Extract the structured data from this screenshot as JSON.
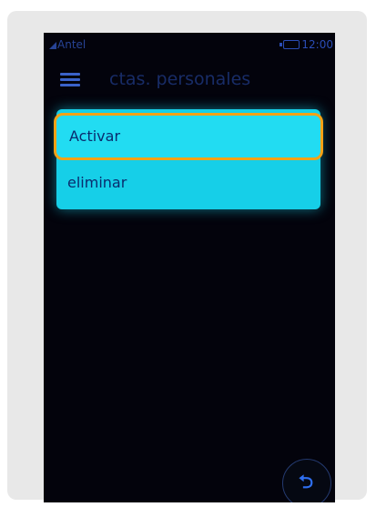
{
  "status_bar": {
    "carrier": "Antel",
    "time": "12:00",
    "signal_icon": "signal-icon",
    "battery_icon": "battery-icon"
  },
  "header": {
    "menu_icon": "menu-icon",
    "title": "ctas. personales"
  },
  "popup_menu": {
    "items": [
      {
        "label": "Activar",
        "highlighted": true
      },
      {
        "label": "eliminar",
        "highlighted": false
      }
    ],
    "background_color": "#16cfe8",
    "highlight_border_color": "#f3a216"
  },
  "back_button": {
    "icon": "back-arrow-icon"
  }
}
